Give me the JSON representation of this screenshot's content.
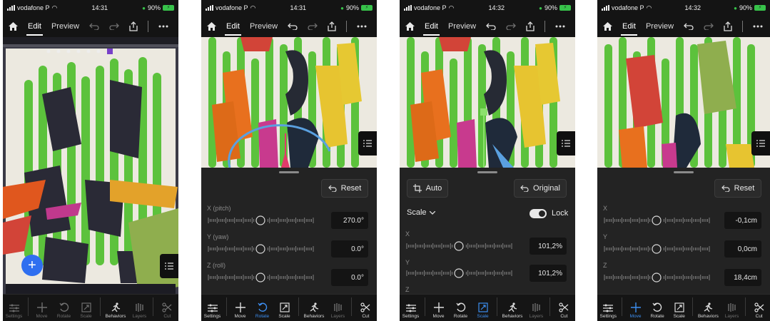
{
  "status": {
    "carrier": "vodafone P",
    "battery": "90%",
    "screens": [
      {
        "time": "14:31"
      },
      {
        "time": "14:31"
      },
      {
        "time": "14:32"
      },
      {
        "time": "14:32"
      }
    ]
  },
  "topbar": {
    "edit_label": "Edit",
    "preview_label": "Preview"
  },
  "toolbar": {
    "settings": "Settings",
    "move": "Move",
    "rotate": "Rotate",
    "scale": "Scale",
    "behaviors": "Behaviors",
    "layers": "Layers",
    "cut": "Cut"
  },
  "screen1": {
    "fab_label": "+",
    "active_tool": "none"
  },
  "screen2": {
    "active_tool": "rotate",
    "reset_label": "Reset",
    "rows": [
      {
        "label": "X (pitch)",
        "value": "270.0°"
      },
      {
        "label": "Y (yaw)",
        "value": "0.0°"
      },
      {
        "label": "Z (roll)",
        "value": "0.0°"
      }
    ]
  },
  "screen3": {
    "active_tool": "scale",
    "auto_label": "Auto",
    "original_label": "Original",
    "mode_label": "Scale",
    "lock_label": "Lock",
    "lock_on": true,
    "rows": [
      {
        "label": "X",
        "value": "101,2%"
      },
      {
        "label": "Y",
        "value": "101,2%"
      },
      {
        "label": "Z",
        "value": ""
      }
    ]
  },
  "screen4": {
    "active_tool": "move",
    "reset_label": "Reset",
    "rows": [
      {
        "label": "X",
        "value": "-0,1cm"
      },
      {
        "label": "Y",
        "value": "0,0cm"
      },
      {
        "label": "Z",
        "value": "18,4cm"
      }
    ]
  },
  "colors": {
    "accent": "#3d8ef0",
    "green_stripes": "#5cc23c",
    "panel": "#232323",
    "toolbar": "#151515"
  }
}
